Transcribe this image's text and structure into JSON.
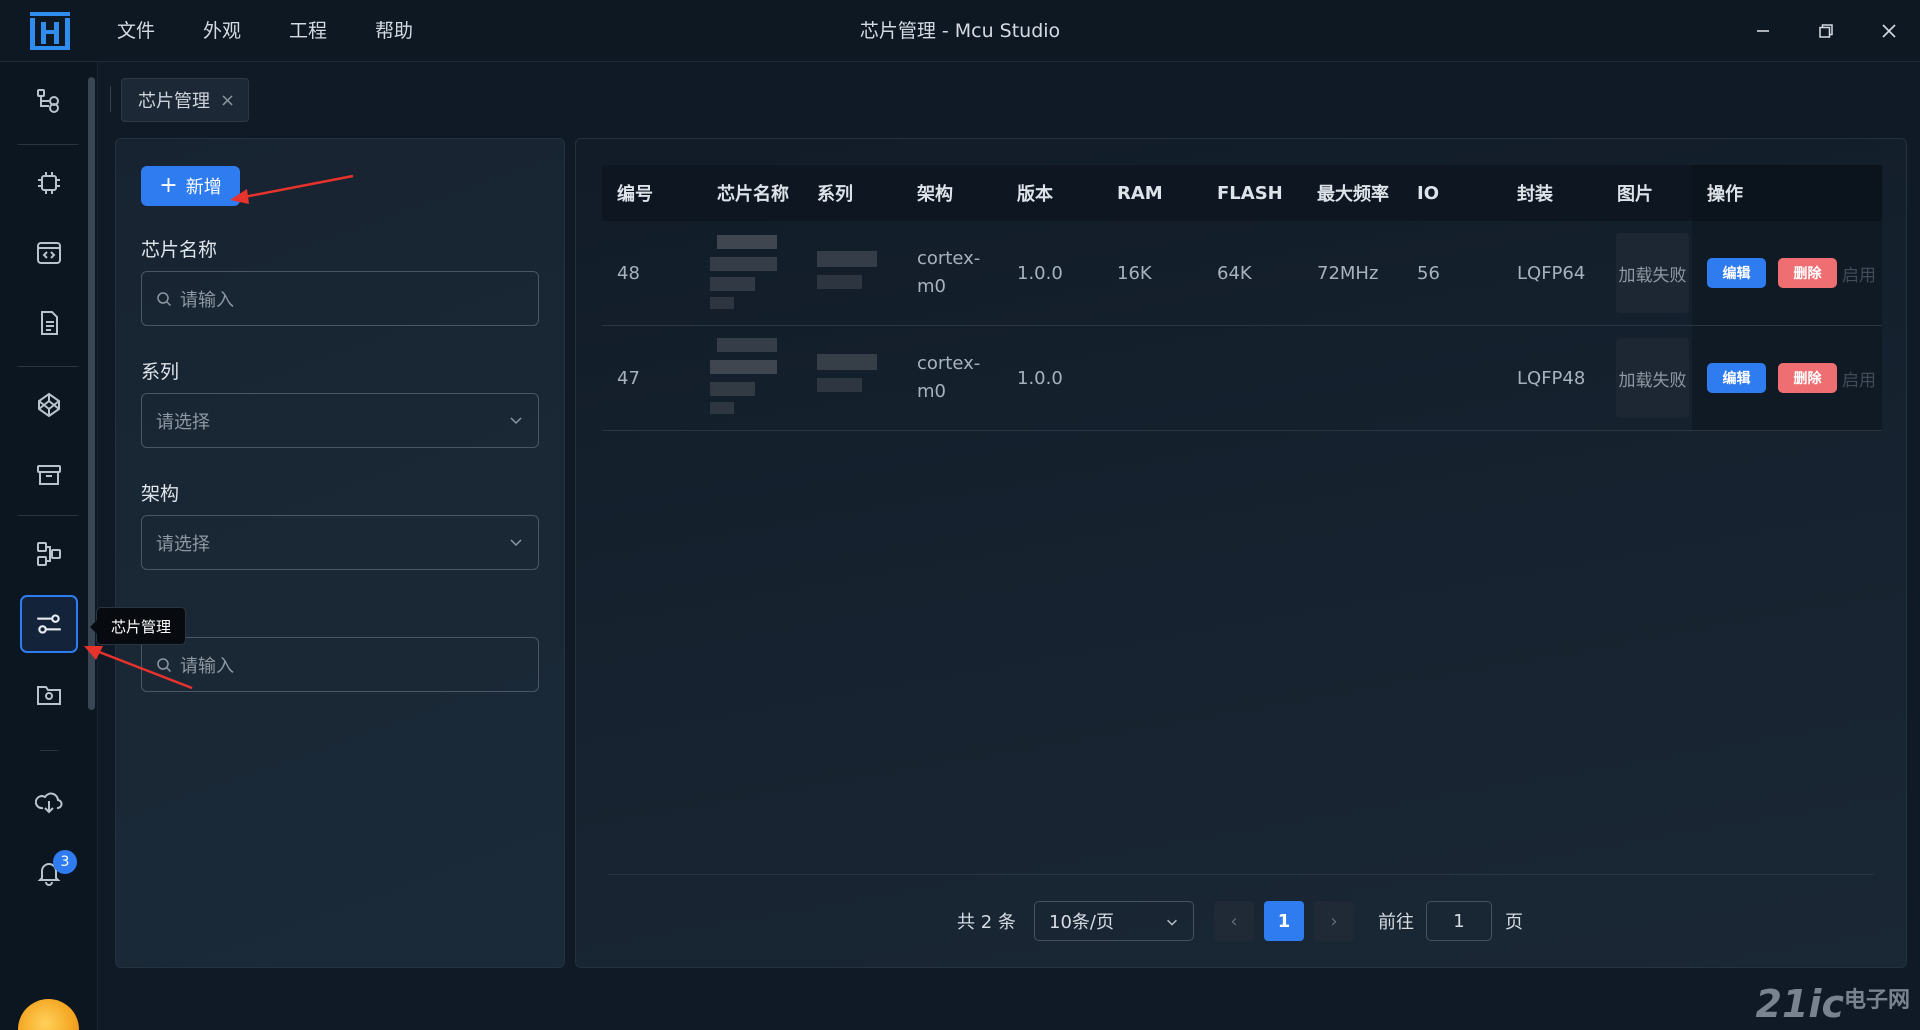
{
  "titlebar": {
    "title": "芯片管理 - Mcu Studio",
    "menu": [
      "文件",
      "外观",
      "工程",
      "帮助"
    ]
  },
  "sidenav": {
    "items": [
      {
        "icon": "workflow-icon"
      },
      {
        "icon": "chip-icon"
      },
      {
        "icon": "code-window-icon"
      },
      {
        "icon": "document-icon"
      },
      {
        "icon": "codepen-cube-icon"
      },
      {
        "icon": "archive-icon"
      },
      {
        "icon": "diagram-nodes-icon"
      },
      {
        "icon": "sliders-icon",
        "active": true
      },
      {
        "icon": "folder-camera-icon"
      },
      {
        "icon": "cloud-download-icon"
      },
      {
        "icon": "bell-icon",
        "badge": "3"
      }
    ],
    "tooltip": "芯片管理",
    "accent": "#2f7bf0"
  },
  "tabs": [
    {
      "label": "芯片管理",
      "close": "×"
    }
  ],
  "filters": {
    "add_label": "新增",
    "chip_name_label": "芯片名称",
    "chip_name_placeholder": "请输入",
    "series_label": "系列",
    "series_placeholder": "请选择",
    "arch_label": "架构",
    "arch_placeholder": "请选择",
    "fourth_placeholder": "请输入"
  },
  "table": {
    "headers": [
      "编号",
      "芯片名称",
      "系列",
      "架构",
      "版本",
      "RAM",
      "FLASH",
      "最大频率",
      "IO",
      "封装",
      "图片",
      "操作"
    ],
    "rows": [
      {
        "id": "48",
        "arch_line1": "cortex-",
        "arch_line2": "m0",
        "version": "1.0.0",
        "ram": "16K",
        "flash": "64K",
        "freq": "72MHz",
        "io": "56",
        "package": "LQFP64",
        "image": "加载失败",
        "edit": "编辑",
        "delete": "删除",
        "enable": "启用"
      },
      {
        "id": "47",
        "arch_line1": "cortex-",
        "arch_line2": "m0",
        "version": "1.0.0",
        "ram": "",
        "flash": "",
        "freq": "",
        "io": "",
        "package": "LQFP48",
        "image": "加载失败",
        "edit": "编辑",
        "delete": "删除",
        "enable": "启用"
      }
    ]
  },
  "pagination": {
    "total": "共 2 条",
    "page_size": "10条/页",
    "current": "1",
    "goto_prefix": "前往",
    "goto_value": "1",
    "goto_suffix": "页"
  },
  "watermark": {
    "main": "21ic",
    "sub": "电子网"
  }
}
